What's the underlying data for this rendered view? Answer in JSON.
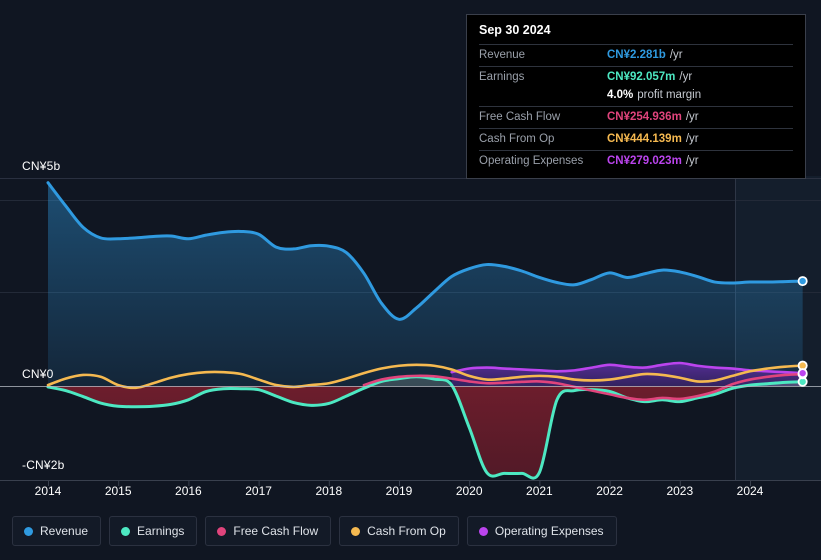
{
  "tooltip": {
    "date": "Sep 30 2024",
    "rows": [
      {
        "key": "Revenue",
        "value": "CN¥2.281b",
        "suffix": "/yr",
        "color": "#2f9ae0"
      },
      {
        "key": "Earnings",
        "value": "CN¥92.057m",
        "suffix": "/yr",
        "color": "#4de8c2"
      },
      {
        "key": "",
        "value": "4.0%",
        "suffix": "profit margin",
        "color": "#ffffff"
      },
      {
        "key": "Free Cash Flow",
        "value": "CN¥254.936m",
        "suffix": "/yr",
        "color": "#e0447c"
      },
      {
        "key": "Cash From Op",
        "value": "CN¥444.139m",
        "suffix": "/yr",
        "color": "#f5b950"
      },
      {
        "key": "Operating Expenses",
        "value": "CN¥279.023m",
        "suffix": "/yr",
        "color": "#bb44ee"
      }
    ]
  },
  "legend": [
    {
      "label": "Revenue",
      "color": "#2f9ae0"
    },
    {
      "label": "Earnings",
      "color": "#4de8c2"
    },
    {
      "label": "Free Cash Flow",
      "color": "#e0447c"
    },
    {
      "label": "Cash From Op",
      "color": "#f5b950"
    },
    {
      "label": "Operating Expenses",
      "color": "#bb44ee"
    }
  ],
  "axis": {
    "y_top": "CN¥5b",
    "y_zero": "CN¥0",
    "y_bottom": "-CN¥2b",
    "x_ticks": [
      "2014",
      "2015",
      "2016",
      "2017",
      "2018",
      "2019",
      "2020",
      "2021",
      "2022",
      "2023",
      "2024"
    ]
  },
  "chart_data": {
    "type": "area",
    "title": "",
    "xlabel": "",
    "ylabel": "CN¥",
    "ylim": [
      -2.3,
      5.0
    ],
    "xlim": [
      2013.9,
      2024.9
    ],
    "grid": true,
    "legend_position": "bottom",
    "currency": "CN¥",
    "units": "billions per year",
    "forecast_start": 2024.0,
    "x": [
      2014.0,
      2014.25,
      2014.5,
      2014.75,
      2015.0,
      2015.25,
      2015.5,
      2015.75,
      2016.0,
      2016.25,
      2016.5,
      2016.75,
      2017.0,
      2017.25,
      2017.5,
      2017.75,
      2018.0,
      2018.25,
      2018.5,
      2018.75,
      2019.0,
      2019.25,
      2019.5,
      2019.75,
      2020.0,
      2020.25,
      2020.5,
      2020.75,
      2021.0,
      2021.25,
      2021.5,
      2021.75,
      2022.0,
      2022.25,
      2022.5,
      2022.75,
      2023.0,
      2023.25,
      2023.5,
      2023.75,
      2024.0,
      2024.25,
      2024.5,
      2024.75
    ],
    "series": [
      {
        "name": "Revenue",
        "color": "#2f9ae0",
        "values": [
          4.42,
          3.92,
          3.45,
          3.22,
          3.2,
          3.22,
          3.25,
          3.26,
          3.2,
          3.28,
          3.34,
          3.36,
          3.3,
          3.02,
          2.98,
          3.05,
          3.04,
          2.9,
          2.45,
          1.8,
          1.45,
          1.7,
          2.05,
          2.38,
          2.55,
          2.64,
          2.6,
          2.5,
          2.36,
          2.25,
          2.2,
          2.32,
          2.46,
          2.36,
          2.44,
          2.52,
          2.48,
          2.38,
          2.26,
          2.24,
          2.26,
          2.26,
          2.27,
          2.281
        ]
      },
      {
        "name": "Earnings",
        "color": "#4de8c2",
        "values": [
          -0.02,
          -0.1,
          -0.23,
          -0.37,
          -0.44,
          -0.45,
          -0.44,
          -0.4,
          -0.3,
          -0.12,
          -0.06,
          -0.06,
          -0.08,
          -0.22,
          -0.36,
          -0.42,
          -0.38,
          -0.22,
          -0.05,
          0.1,
          0.16,
          0.2,
          0.15,
          0.02,
          -0.9,
          -1.88,
          -1.9,
          -1.9,
          -1.88,
          -0.3,
          -0.1,
          -0.08,
          -0.12,
          -0.26,
          -0.34,
          -0.3,
          -0.34,
          -0.26,
          -0.18,
          -0.05,
          0.02,
          0.05,
          0.08,
          0.092
        ]
      },
      {
        "name": "Free Cash Flow",
        "color": "#e0447c",
        "values": [
          null,
          null,
          null,
          null,
          null,
          null,
          null,
          null,
          null,
          null,
          null,
          null,
          null,
          null,
          null,
          null,
          null,
          null,
          0.02,
          0.14,
          0.2,
          0.22,
          0.21,
          0.16,
          0.1,
          0.06,
          0.07,
          0.09,
          0.1,
          0.06,
          -0.02,
          -0.1,
          -0.18,
          -0.26,
          -0.3,
          -0.26,
          -0.28,
          -0.22,
          -0.12,
          0.04,
          0.14,
          0.2,
          0.24,
          0.255
        ]
      },
      {
        "name": "Cash From Op",
        "color": "#f5b950",
        "values": [
          0.02,
          0.16,
          0.24,
          0.2,
          0.02,
          -0.04,
          0.06,
          0.18,
          0.26,
          0.3,
          0.3,
          0.26,
          0.14,
          0.02,
          -0.02,
          0.02,
          0.06,
          0.16,
          0.28,
          0.38,
          0.44,
          0.46,
          0.44,
          0.36,
          0.22,
          0.14,
          0.16,
          0.2,
          0.22,
          0.2,
          0.14,
          0.12,
          0.14,
          0.2,
          0.26,
          0.24,
          0.18,
          0.1,
          0.12,
          0.22,
          0.32,
          0.38,
          0.42,
          0.444
        ]
      },
      {
        "name": "Operating Expenses",
        "color": "#bb44ee",
        "values": [
          null,
          null,
          null,
          null,
          null,
          null,
          null,
          null,
          null,
          null,
          null,
          null,
          null,
          null,
          null,
          null,
          null,
          null,
          null,
          null,
          null,
          null,
          null,
          0.3,
          0.38,
          0.4,
          0.38,
          0.36,
          0.34,
          0.32,
          0.34,
          0.4,
          0.46,
          0.42,
          0.4,
          0.46,
          0.5,
          0.44,
          0.4,
          0.38,
          0.34,
          0.32,
          0.3,
          0.279
        ]
      }
    ]
  }
}
